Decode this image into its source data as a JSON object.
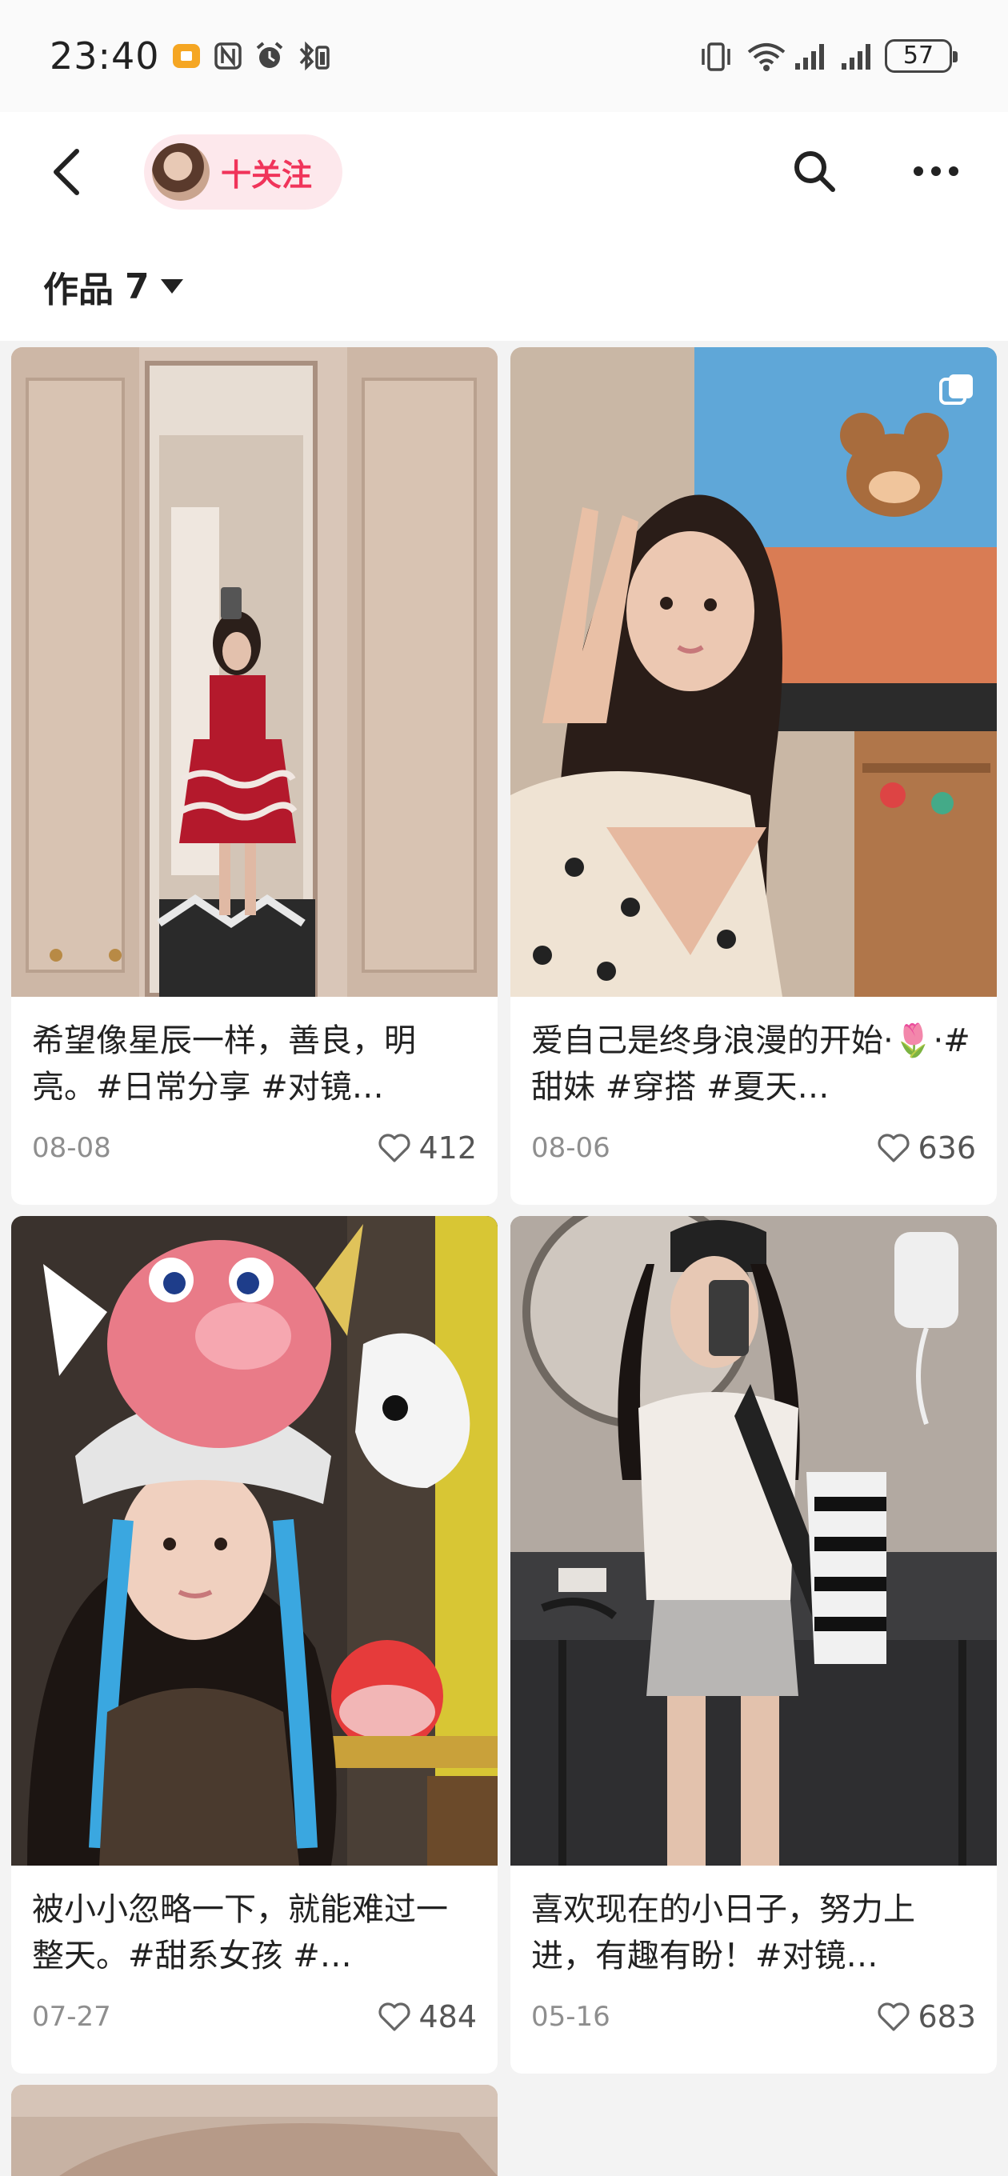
{
  "status_bar": {
    "time": "23:40",
    "battery": "57",
    "icons": [
      "notification-dot-icon",
      "nfc-icon",
      "alarm-icon",
      "bluetooth-icon",
      "vibrate-icon",
      "wifi-icon",
      "signal-icon",
      "signal-icon"
    ]
  },
  "nav": {
    "follow_label": "十关注",
    "icons": [
      "back-arrow-icon",
      "search-icon",
      "more-icon"
    ]
  },
  "works": {
    "label": "作品",
    "count": "7"
  },
  "colors": {
    "accent": "#f0345a",
    "pill_bg": "#fde8ec",
    "page_bg": "#f3f3f3"
  },
  "posts": [
    {
      "title": "希望像星辰一样，善良，明亮。#日常分享 #对镜…",
      "date": "08-08",
      "likes": "412",
      "multi_image": false
    },
    {
      "title": "爱自己是终身浪漫的开始·🌷·#甜妹 #穿搭 #夏天…",
      "date": "08-06",
      "likes": "636",
      "multi_image": true
    },
    {
      "title": "被小小忽略一下，就能难过一整天。#甜系女孩 #…",
      "date": "07-27",
      "likes": "484",
      "multi_image": false
    },
    {
      "title": "喜欢现在的小日子，努力上进，有趣有盼！#对镜…",
      "date": "05-16",
      "likes": "683",
      "multi_image": false
    }
  ]
}
